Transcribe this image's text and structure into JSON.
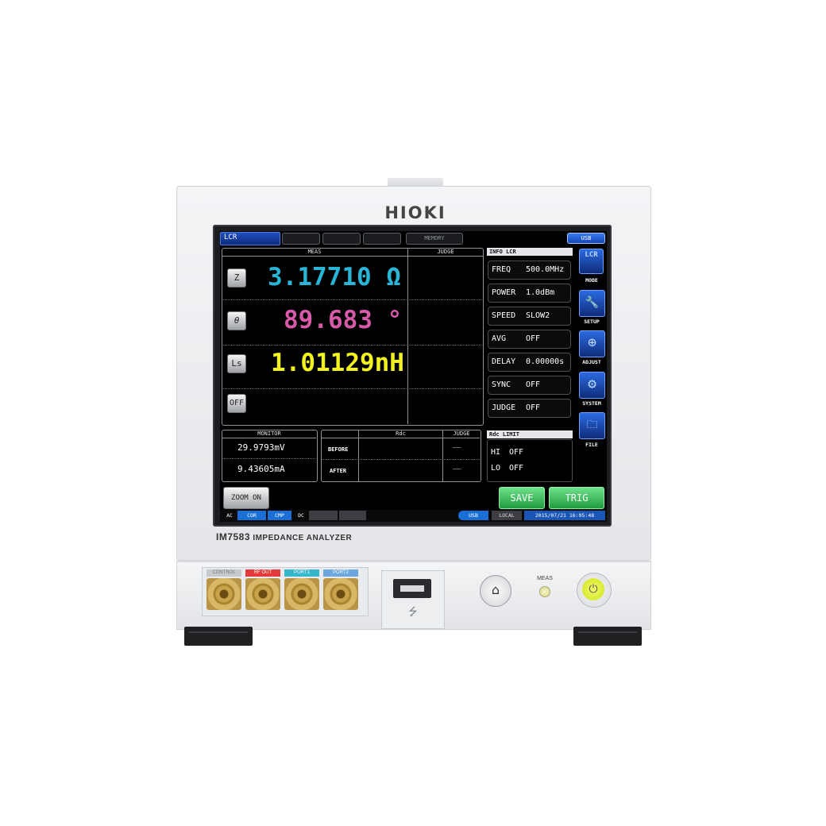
{
  "device": {
    "brand": "HIOKI",
    "model": "IM7583",
    "model_desc": "IMPEDANCE ANALYZER",
    "ports": [
      "CONTROL",
      "RF OUT",
      "PORT1",
      "PORT2"
    ],
    "meas_led_label": "MEAS",
    "usb_symbol": "⭍",
    "home_icon": "⌂",
    "power_icon": "⏻"
  },
  "screen": {
    "mode_tab": "LCR",
    "memory_tab": "MEMORY",
    "usb_badge": "USB",
    "meas_header": "MEAS",
    "judge_header": "JUDGE",
    "params": [
      {
        "key": "Z",
        "value": "3.17710 Ω",
        "color": "#29b6d6"
      },
      {
        "key": "θ",
        "value": "89.683 °",
        "color": "#d65aa9"
      },
      {
        "key": "Ls",
        "value": "1.01129nH",
        "color": "#f2f21c"
      },
      {
        "key": "OFF",
        "value": "",
        "color": "#ffffff"
      }
    ],
    "info": {
      "title": "INFO LCR",
      "rows": [
        {
          "label": "FREQ",
          "value": "500.0MHz"
        },
        {
          "label": "POWER",
          "value": "1.0dBm"
        },
        {
          "label": "SPEED",
          "value": "SLOW2"
        },
        {
          "label": "AVG",
          "value": "OFF"
        },
        {
          "label": "DELAY",
          "value": "0.00000s"
        },
        {
          "label": "SYNC",
          "value": "OFF"
        },
        {
          "label": "JUDGE",
          "value": "OFF"
        }
      ]
    },
    "side_buttons": [
      {
        "label": "MODE",
        "icon": "LCR"
      },
      {
        "label": "SETUP",
        "icon": "🔧"
      },
      {
        "label": "ADJUST",
        "icon": "⊕"
      },
      {
        "label": "SYSTEM",
        "icon": "⚙"
      },
      {
        "label": "FILE",
        "icon": "🗀"
      }
    ],
    "monitor": {
      "title": "MONITOR",
      "voltage": "29.9793mV",
      "current": "9.43605mA"
    },
    "rdc": {
      "rdc_header": "Rdc",
      "judge_header": "JUDGE",
      "before_label": "BEFORE",
      "after_label": "AFTER",
      "before_judge": "––",
      "after_judge": "––"
    },
    "rdc_limit": {
      "title": "Rdc LIMIT",
      "hi_label": "HI",
      "hi_value": "OFF",
      "lo_label": "LO",
      "lo_value": "OFF"
    },
    "buttons": {
      "zoom": "ZOOM ON",
      "save": "SAVE",
      "trig": "TRIG"
    },
    "status": {
      "ac": "AC",
      "cor": "COR",
      "cmp": "CMP",
      "dc": "DC",
      "usb": "USB",
      "local": "LOCAL",
      "datetime": "2015/07/21 16:05:48"
    }
  }
}
